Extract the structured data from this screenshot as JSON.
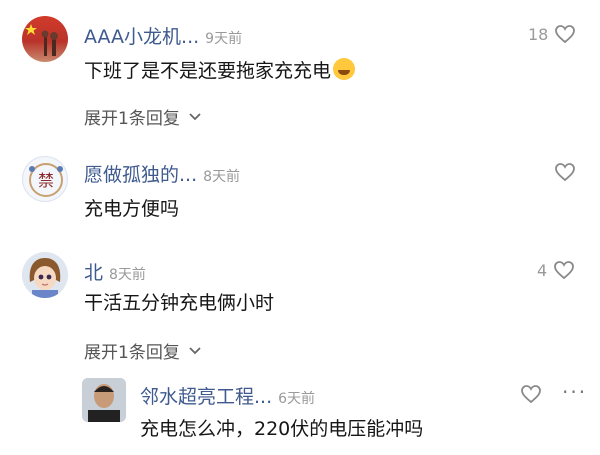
{
  "comments": [
    {
      "username": "AAA小龙机...",
      "time": "9天前",
      "text": "下班了是不是还要拖家充充电",
      "likes": "18",
      "expand_label": "展开1条回复",
      "emoji": "laughing-crying-emoji"
    },
    {
      "username": "愿做孤独的...",
      "time": "8天前",
      "text": "充电方便吗",
      "likes": ""
    },
    {
      "username": "北",
      "time": "8天前",
      "text": "干活五分钟充电俩小时",
      "likes": "4",
      "expand_label": "展开1条回复"
    }
  ],
  "reply": {
    "username": "邻水超亮工程...",
    "time": "6天前",
    "text": "充电怎么冲，220伏的电压能冲吗",
    "more_label": "···"
  },
  "colors": {
    "username": "#3f5a8f",
    "time": "#9a9a9a",
    "text": "#161616"
  }
}
